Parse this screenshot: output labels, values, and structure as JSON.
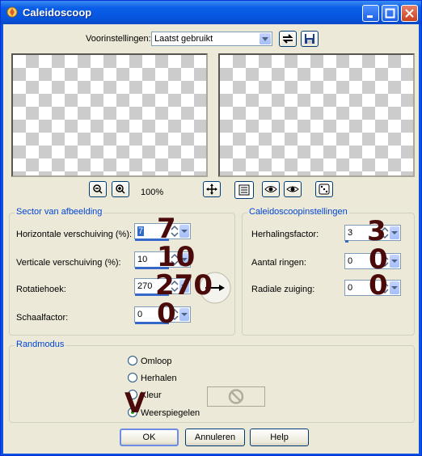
{
  "window": {
    "title": "Caleidoscoop"
  },
  "presets": {
    "label": "Voorinstellingen:",
    "value": "Laatst gebruikt"
  },
  "preview": {
    "zoom": "100%"
  },
  "sector": {
    "title": "Sector van afbeelding",
    "horizontal": {
      "label": "Horizontale verschuiving (%):",
      "value": "7",
      "annotation": "7"
    },
    "vertical": {
      "label": "Verticale verschuiving (%):",
      "value": "10",
      "annotation": "10"
    },
    "rotation": {
      "label": "Rotatiehoek:",
      "value": "270",
      "annotation": "270"
    },
    "scale": {
      "label": "Schaalfactor:",
      "value": "0",
      "annotation": "0"
    }
  },
  "kaleido": {
    "title": "Caleidoscoopinstellingen",
    "repeat": {
      "label": "Herhalingsfactor:",
      "value": "3",
      "annotation": "3"
    },
    "rings": {
      "label": "Aantal ringen:",
      "value": "0",
      "annotation": "0"
    },
    "radial": {
      "label": "Radiale zuiging:",
      "value": "0",
      "annotation": "0"
    }
  },
  "edge": {
    "title": "Randmodus",
    "options": [
      "Omloop",
      "Herhalen",
      "Kleur",
      "Weerspiegelen"
    ],
    "selected": "Weerspiegelen",
    "annotation": "V"
  },
  "buttons": {
    "ok": "OK",
    "cancel": "Annuleren",
    "help": "Help"
  },
  "colors": {
    "titlebar": "#0a5ee7",
    "face": "#ece9d8",
    "group_title": "#0046d5",
    "annotation": "#4a0a0a"
  }
}
